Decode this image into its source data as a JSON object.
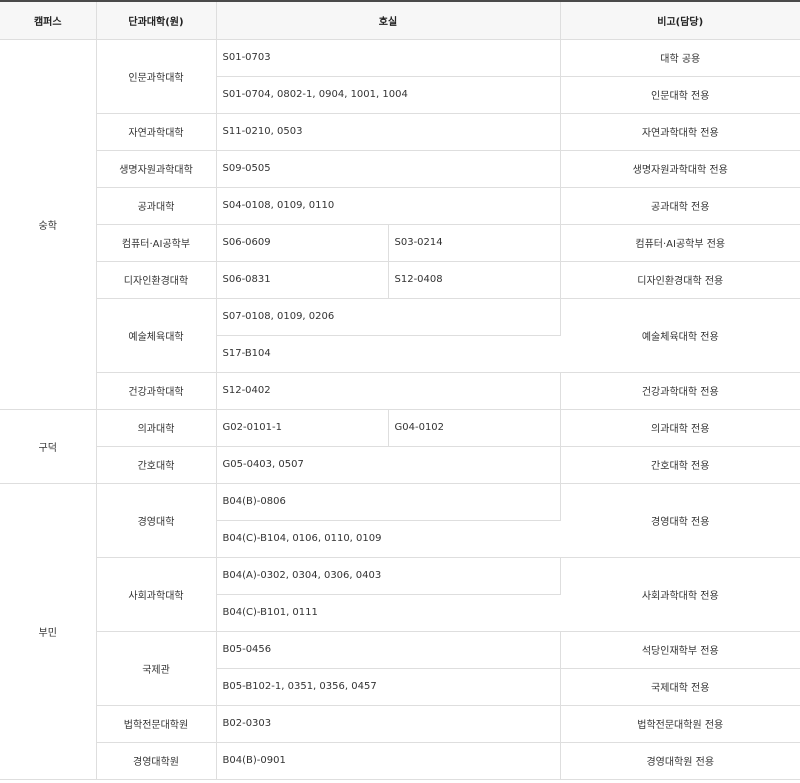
{
  "headers": {
    "campus": "캠퍼스",
    "college": "단과대학(원)",
    "room": "호실",
    "note": "비고(담당)"
  },
  "campuses": [
    {
      "name": "숭학",
      "colleges": [
        {
          "name": "인문과학대학",
          "rows": [
            {
              "rooms": [
                "S01-0703"
              ],
              "note": "대학 공용"
            },
            {
              "rooms": [
                "S01-0704, 0802-1, 0904, 1001, 1004"
              ],
              "note": "인문대학 전용"
            }
          ]
        },
        {
          "name": "자연과학대학",
          "rows": [
            {
              "rooms": [
                "S11-0210, 0503"
              ],
              "note": "자연과학대학 전용"
            }
          ]
        },
        {
          "name": "생명자원과학대학",
          "rows": [
            {
              "rooms": [
                "S09-0505"
              ],
              "note": "생명자원과학대학 전용"
            }
          ]
        },
        {
          "name": "공과대학",
          "rows": [
            {
              "rooms": [
                "S04-0108, 0109, 0110"
              ],
              "note": "공과대학 전용"
            }
          ]
        },
        {
          "name": "컴퓨터·AI공학부",
          "rows": [
            {
              "rooms": [
                "S06-0609",
                "S03-0214"
              ],
              "note": "컴퓨터·AI공학부 전용"
            }
          ]
        },
        {
          "name": "디자인환경대학",
          "rows": [
            {
              "rooms": [
                "S06-0831",
                "S12-0408"
              ],
              "note": "디자인환경대학 전용"
            }
          ]
        },
        {
          "name": "예술체육대학",
          "rows": [
            {
              "rooms": [
                "S07-0108, 0109, 0206"
              ],
              "note": "예술체육대학 전용"
            },
            {
              "rooms": [
                "S17-B104"
              ]
            }
          ]
        },
        {
          "name": "건강과학대학",
          "rows": [
            {
              "rooms": [
                "S12-0402"
              ],
              "note": "건강과학대학 전용"
            }
          ]
        }
      ]
    },
    {
      "name": "구덕",
      "colleges": [
        {
          "name": "의과대학",
          "rows": [
            {
              "rooms": [
                "G02-0101-1",
                "G04-0102"
              ],
              "note": "의과대학 전용"
            }
          ]
        },
        {
          "name": "간호대학",
          "rows": [
            {
              "rooms": [
                "G05-0403, 0507"
              ],
              "note": "간호대학 전용"
            }
          ]
        }
      ]
    },
    {
      "name": "부민",
      "colleges": [
        {
          "name": "경영대학",
          "rows": [
            {
              "rooms": [
                "B04(B)-0806"
              ],
              "note": "경영대학 전용"
            },
            {
              "rooms": [
                "B04(C)-B104, 0106, 0110, 0109"
              ]
            }
          ]
        },
        {
          "name": "사회과학대학",
          "rows": [
            {
              "rooms": [
                "B04(A)-0302, 0304, 0306, 0403"
              ],
              "note": "사회과학대학 전용"
            },
            {
              "rooms": [
                "B04(C)-B101, 0111"
              ]
            }
          ]
        },
        {
          "name": "국제관",
          "rows": [
            {
              "rooms": [
                "B05-0456"
              ],
              "note": "석당인재학부 전용"
            },
            {
              "rooms": [
                "B05-B102-1, 0351, 0356, 0457"
              ],
              "note": "국제대학 전용"
            }
          ]
        },
        {
          "name": "법학전문대학원",
          "rows": [
            {
              "rooms": [
                "B02-0303"
              ],
              "note": "법학전문대학원 전용"
            }
          ]
        },
        {
          "name": "경영대학원",
          "rows": [
            {
              "rooms": [
                "B04(B)-0901"
              ],
              "note": "경영대학원 전용"
            }
          ]
        }
      ]
    }
  ]
}
